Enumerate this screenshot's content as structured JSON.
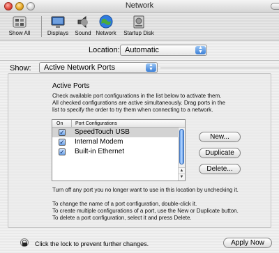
{
  "window": {
    "title": "Network"
  },
  "toolbar": {
    "items": [
      {
        "label": "Show All",
        "icon": "show-all-icon"
      },
      {
        "label": "Displays",
        "icon": "displays-icon"
      },
      {
        "label": "Sound",
        "icon": "sound-icon"
      },
      {
        "label": "Network",
        "icon": "network-icon"
      },
      {
        "label": "Startup Disk",
        "icon": "startup-disk-icon"
      }
    ]
  },
  "location": {
    "label": "Location:",
    "value": "Automatic"
  },
  "show": {
    "label": "Show:",
    "value": "Active Network Ports"
  },
  "active_ports": {
    "heading": "Active Ports",
    "description_lines": [
      "Check available port configurations in the list below to activate them.",
      "All checked configurations are active simultaneously. Drag ports in the",
      "list to specify the order to try them when connecting to a network."
    ],
    "columns": {
      "on": "On",
      "port": "Port Configurations"
    },
    "ports": [
      {
        "name": "SpeedTouch USB",
        "checked": true,
        "selected": true
      },
      {
        "name": "Internal Modem",
        "checked": true,
        "selected": false
      },
      {
        "name": "Built-in Ethernet",
        "checked": true,
        "selected": false
      }
    ],
    "buttons": {
      "new": "New...",
      "duplicate": "Duplicate",
      "delete": "Delete..."
    },
    "note1": "Turn off any port you no longer want to use in this location by unchecking it.",
    "note2_lines": [
      "To change the name of a port configuration, double-click it.",
      "To create multiple configurations of a port, use the New or Duplicate button.",
      "To delete a port configuration, select it and press Delete."
    ]
  },
  "footer": {
    "lock_text": "Click the lock to prevent further changes.",
    "apply_label": "Apply Now"
  },
  "colors": {
    "accent": "#3b7fd7",
    "selection": "#d3d3d3"
  }
}
